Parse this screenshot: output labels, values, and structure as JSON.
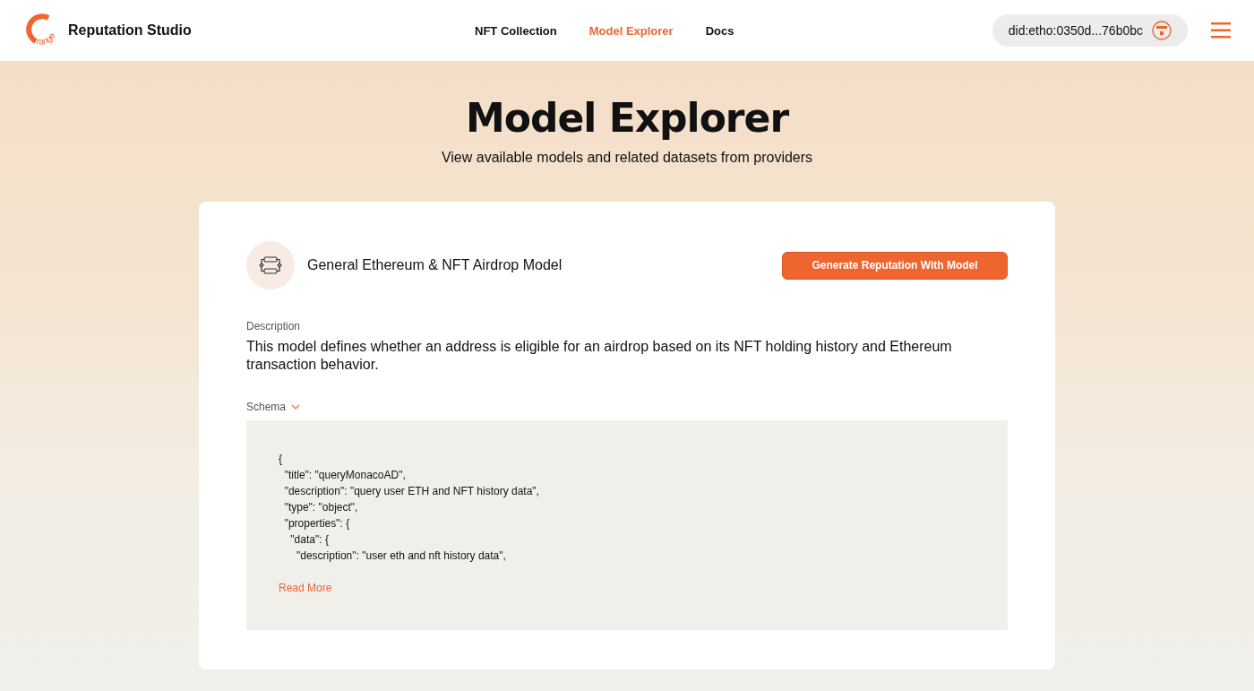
{
  "header": {
    "logo_mark": "range",
    "brand": "Reputation Studio",
    "nav": [
      {
        "label": "NFT Collection",
        "selected": false
      },
      {
        "label": "Model Explorer",
        "selected": true
      },
      {
        "label": "Docs",
        "selected": false
      }
    ],
    "account": "did:etho:0350d...76b0bc"
  },
  "hero": {
    "title": "Model Explorer",
    "subtitle": "View available models and related datasets from providers"
  },
  "model": {
    "name": "General Ethereum & NFT Airdrop Model",
    "action": "Generate Reputation With Model",
    "description_label": "Description",
    "description": "This model defines whether an address is eligible for an airdrop based on its NFT holding history and Ethereum transaction behavior.",
    "schema_label": "Schema",
    "schema_expanded": true,
    "schema_lines": [
      "{",
      "  \"title\": \"queryMonacoAD\",",
      "  \"description\": \"query user ETH and NFT history data\",",
      "  \"type\": \"object\",",
      "  \"properties\": {",
      "    \"data\": {",
      "      \"description\": \"user eth and nft history data\","
    ],
    "read_more": "Read More"
  }
}
